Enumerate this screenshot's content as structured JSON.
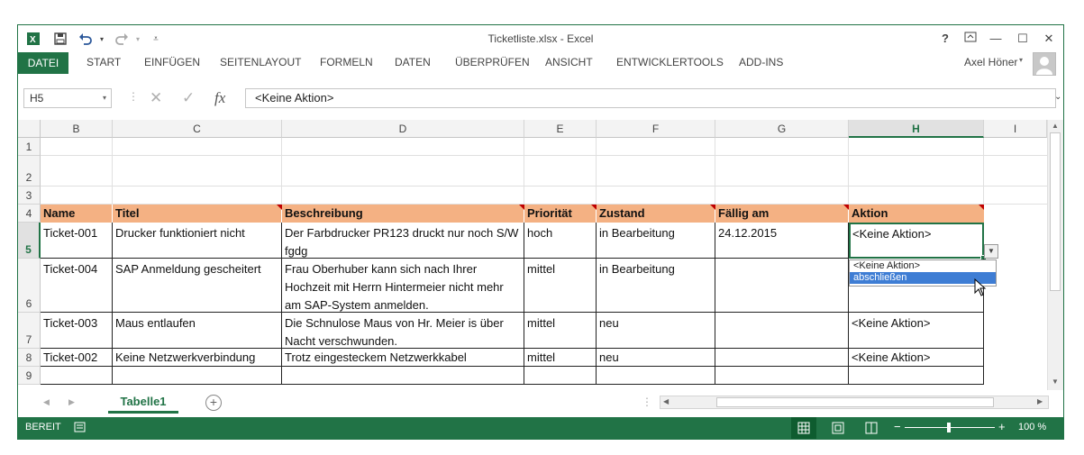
{
  "window": {
    "title": "Ticketliste.xlsx - Excel"
  },
  "qat": {
    "excel_icon": "excel-icon",
    "save_icon": "save-icon",
    "undo_icon": "undo-icon",
    "redo_icon": "redo-icon"
  },
  "window_buttons": {
    "help": "?",
    "ribbon_display": "⬚",
    "minimize": "—",
    "maximize": "☐",
    "close": "✕"
  },
  "ribbon": {
    "tabs": [
      "DATEI",
      "START",
      "EINFÜGEN",
      "SEITENLAYOUT",
      "FORMELN",
      "DATEN",
      "ÜBERPRÜFEN",
      "ANSICHT",
      "ENTWICKLERTOOLS",
      "ADD-INS"
    ],
    "active_tab": "DATEI",
    "user": "Axel Höner"
  },
  "formula_bar": {
    "name_box": "H5",
    "fx_label": "fx",
    "value": "<Keine Aktion>"
  },
  "columns": [
    "B",
    "C",
    "D",
    "E",
    "F",
    "G",
    "H",
    "I"
  ],
  "selected_column": "H",
  "rows": [
    "1",
    "2",
    "3",
    "4",
    "5",
    "6",
    "7",
    "8",
    "9"
  ],
  "selected_row": "5",
  "table": {
    "headers": [
      "Name",
      "Titel",
      "Beschreibung",
      "Priorität",
      "Zustand",
      "Fällig am",
      "Aktion"
    ],
    "rows": [
      [
        "Ticket-001",
        "Drucker funktioniert nicht",
        "Der Farbdrucker PR123 druckt nur noch S/W fgdg",
        "hoch",
        "in Bearbeitung",
        "24.12.2015",
        "<Keine Aktion>"
      ],
      [
        "Ticket-004",
        "SAP Anmeldung gescheitert",
        "Frau Oberhuber kann sich nach Ihrer Hochzeit mit Herrn Hintermeier nicht mehr am SAP-System anmelden.",
        "mittel",
        "in Bearbeitung",
        "",
        ""
      ],
      [
        "Ticket-003",
        "Maus entlaufen",
        "Die Schnulose Maus von Hr. Meier is über Nacht verschwunden.",
        "mittel",
        "neu",
        "",
        "<Keine Aktion>"
      ],
      [
        "Ticket-002",
        "Keine Netzwerkverbindung",
        "Trotz eingesteckem Netzwerkkabel",
        "mittel",
        "neu",
        "",
        "<Keine Aktion>"
      ]
    ]
  },
  "dropdown": {
    "options": [
      "<Keine Aktion>",
      "abschließen"
    ],
    "highlighted": "abschließen"
  },
  "sheet_tabs": {
    "active": "Tabelle1",
    "add_label": "+"
  },
  "status_bar": {
    "mode": "BEREIT",
    "zoom": "100 %",
    "zoom_minus": "−",
    "zoom_plus": "+"
  },
  "colors": {
    "accent": "#217346",
    "table_header": "#f4b183",
    "dropdown_highlight": "#3e7dd4"
  }
}
